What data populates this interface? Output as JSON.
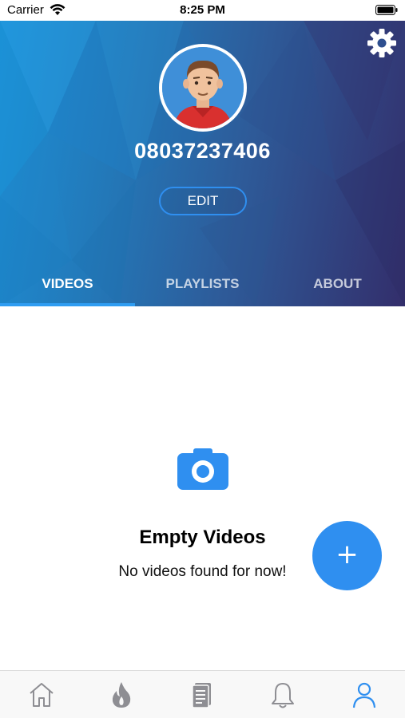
{
  "status_bar": {
    "carrier": "Carrier",
    "time": "8:25 PM"
  },
  "profile": {
    "phone_number": "08037237406",
    "edit_label": "EDIT"
  },
  "tabs": [
    {
      "label": "VIDEOS",
      "active": true
    },
    {
      "label": "PLAYLISTS",
      "active": false
    },
    {
      "label": "ABOUT",
      "active": false
    }
  ],
  "empty_state": {
    "title": "Empty Videos",
    "subtitle": "No videos found for now!",
    "icon": "camera-icon"
  },
  "fab": {
    "label": "+",
    "icon": "plus-icon"
  },
  "bottom_nav": [
    {
      "icon": "home-icon",
      "active": false
    },
    {
      "icon": "flame-icon",
      "active": false
    },
    {
      "icon": "document-icon",
      "active": false
    },
    {
      "icon": "bell-icon",
      "active": false
    },
    {
      "icon": "user-icon",
      "active": true
    }
  ],
  "colors": {
    "accent": "#2f8ff0",
    "header_start": "#1c8fd6",
    "header_end": "#332e6b",
    "inactive_icon": "#8e8e93"
  }
}
